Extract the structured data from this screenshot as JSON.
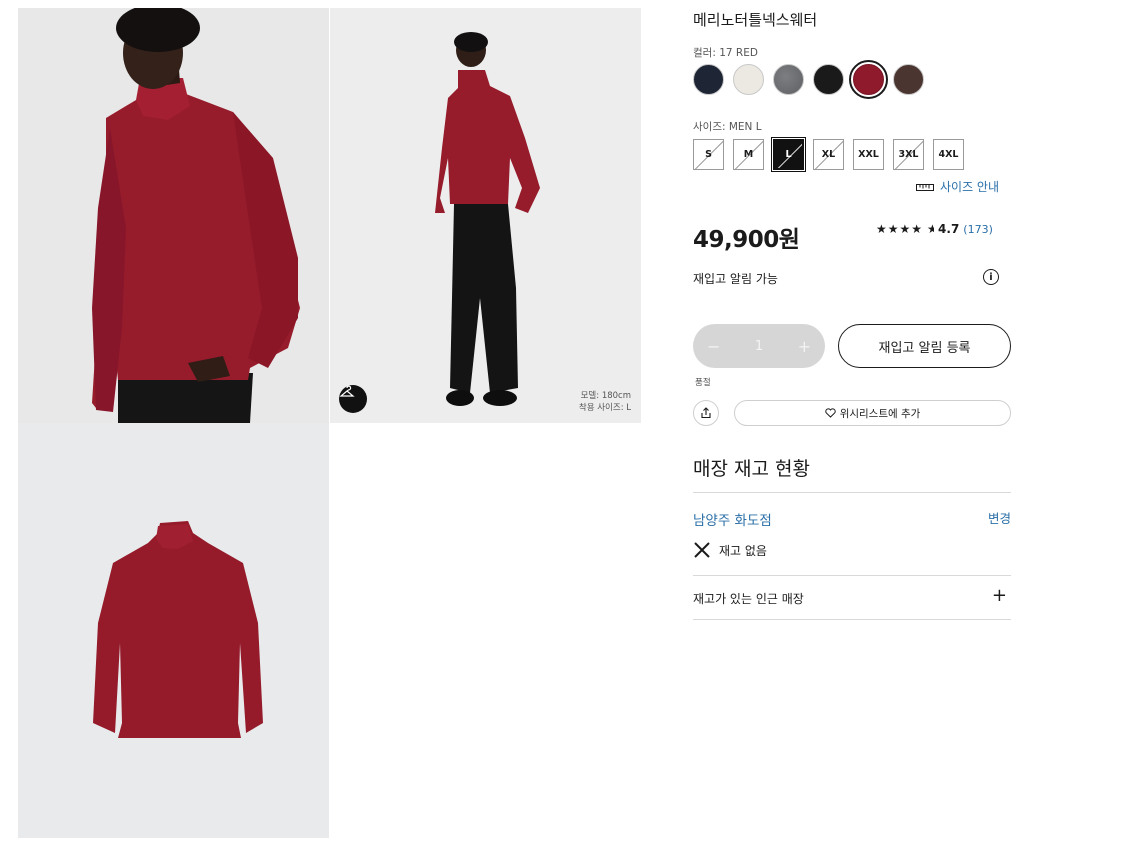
{
  "gallery": {
    "model_info_line1": "모델: 180cm",
    "model_info_line2": "착용 사이즈: L"
  },
  "product": {
    "name": "메리노터틀넥스웨터",
    "color_label": "컬러: 17 RED",
    "colors": [
      {
        "name": "navy",
        "hex": "#1e2535"
      },
      {
        "name": "off-white",
        "hex": "#ece9e3"
      },
      {
        "name": "gray",
        "hex": "#6d6f72"
      },
      {
        "name": "black",
        "hex": "#1a1a1a"
      },
      {
        "name": "red",
        "hex": "#8e1a2c",
        "selected": true
      },
      {
        "name": "brown",
        "hex": "#4b3530"
      }
    ],
    "size_label": "사이즈: MEN L",
    "sizes": [
      {
        "label": "S",
        "available": false
      },
      {
        "label": "M",
        "available": false
      },
      {
        "label": "L",
        "available": false,
        "selected": true
      },
      {
        "label": "XL",
        "available": false
      },
      {
        "label": "XXL",
        "available": true
      },
      {
        "label": "3XL",
        "available": false
      },
      {
        "label": "4XL",
        "available": true
      }
    ],
    "size_guide": "사이즈 안내",
    "price": "49,900원",
    "rating": {
      "stars": "★★★★",
      "half_star": "★",
      "value": "4.7",
      "count": "(173)"
    },
    "restock_available": "재입고 알림 가능",
    "quantity": {
      "minus": "−",
      "value": "1",
      "plus": "+"
    },
    "restock_button": "재입고 알림 등록",
    "sold_out": "품절",
    "wishlist_button": "위시리스트에 추가"
  },
  "store_stock": {
    "title": "매장 재고 현황",
    "store_name": "남양주 화도점",
    "change": "변경",
    "status": "재고 없음",
    "nearby": "재고가 있는 인근 매장",
    "expand": "+"
  }
}
